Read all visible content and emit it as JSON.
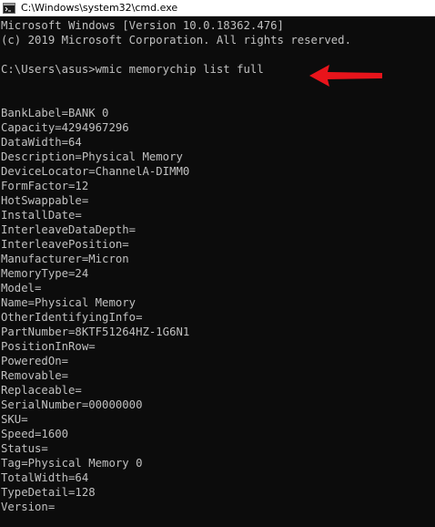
{
  "window": {
    "title": "C:\\Windows\\system32\\cmd.exe",
    "icon": "cmd-icon"
  },
  "console": {
    "header_lines": [
      "Microsoft Windows [Version 10.0.18362.476]",
      "(c) 2019 Microsoft Corporation. All rights reserved."
    ],
    "prompt": "C:\\Users\\asus>wmic memorychip list full",
    "output": [
      "BankLabel=BANK 0",
      "Capacity=4294967296",
      "DataWidth=64",
      "Description=Physical Memory",
      "DeviceLocator=ChannelA-DIMM0",
      "FormFactor=12",
      "HotSwappable=",
      "InstallDate=",
      "InterleaveDataDepth=",
      "InterleavePosition=",
      "Manufacturer=Micron",
      "MemoryType=24",
      "Model=",
      "Name=Physical Memory",
      "OtherIdentifyingInfo=",
      "PartNumber=8KTF51264HZ-1G6N1",
      "PositionInRow=",
      "PoweredOn=",
      "Removable=",
      "Replaceable=",
      "SerialNumber=00000000",
      "SKU=",
      "Speed=1600",
      "Status=",
      "Tag=Physical Memory 0",
      "TotalWidth=64",
      "TypeDetail=128",
      "Version="
    ],
    "text_color": "#c0c0c0",
    "background_color": "#0c0c0c"
  },
  "annotation": {
    "icon": "left-arrow-icon",
    "color": "#e8141b"
  }
}
